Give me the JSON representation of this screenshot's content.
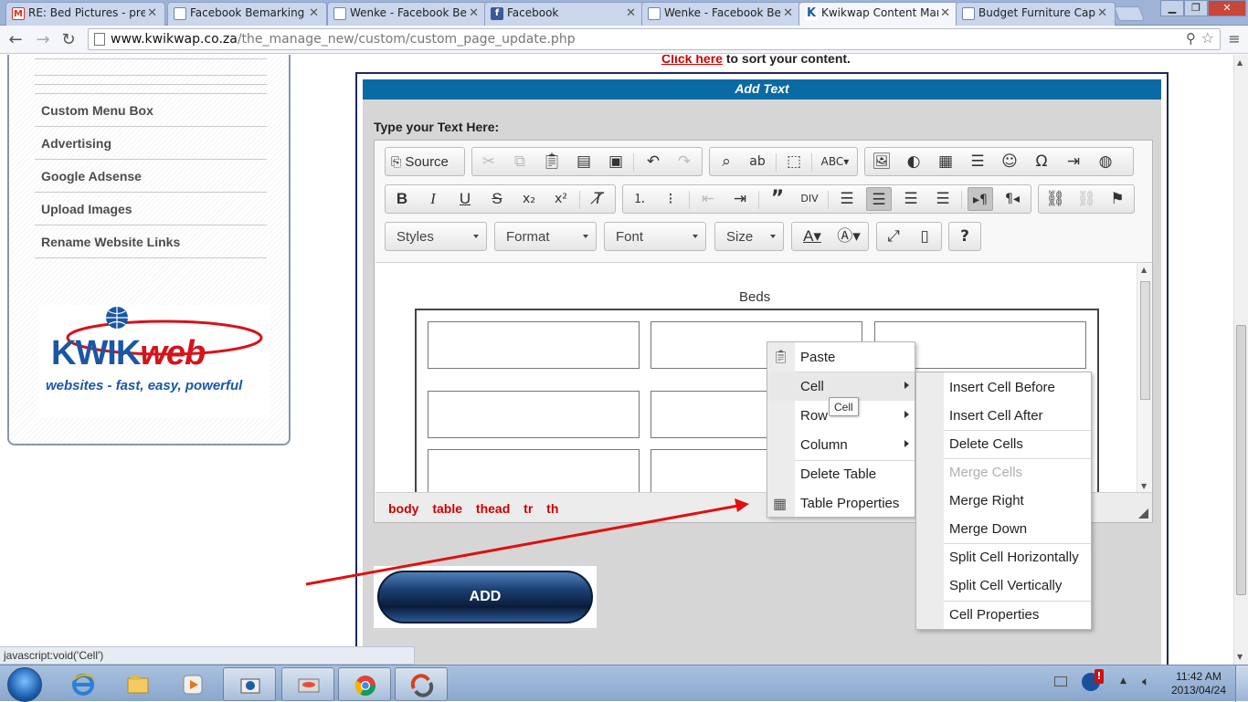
{
  "browser": {
    "tabs": [
      {
        "title": "RE: Bed Pictures - pret",
        "icon": "gmail-icon",
        "color": "#d93025"
      },
      {
        "title": "Facebook Bemarking S",
        "icon": "document-icon",
        "color": "#6d86b5"
      },
      {
        "title": "Wenke - Facebook Ber",
        "icon": "document-icon",
        "color": "#6d86b5"
      },
      {
        "title": "Facebook",
        "icon": "facebook-icon",
        "color": "#3b5998"
      },
      {
        "title": "Wenke - Facebook Ber",
        "icon": "document-icon",
        "color": "#6d86b5"
      },
      {
        "title": "Kwikwap Content Mar",
        "icon": "kwikwap-icon",
        "color": "#1a5fa8",
        "active": true
      },
      {
        "title": "Budget Furniture Cape",
        "icon": "document-icon",
        "color": "#6d86b5"
      }
    ],
    "url_host": "www.kwikwap.co.za",
    "url_path": "/the_manage_new/custom/custom_page_update.php"
  },
  "sidebar": {
    "items": [
      "Custom Menu Box",
      "Advertising",
      "Google Adsense",
      "Upload Images",
      "Rename Website Links"
    ],
    "logo_main_k": "KWIK",
    "logo_main_w": "web",
    "logo_tagline": "websites - fast, easy, powerful"
  },
  "page": {
    "sort_link": "Click here",
    "sort_text": " to sort your content.",
    "section_title": "Add Text",
    "type_label": "Type your Text Here:",
    "add_button": "ADD"
  },
  "editor": {
    "source_label": "Source",
    "combos": [
      "Styles",
      "Format",
      "Font",
      "Size"
    ],
    "caption": "Beds",
    "path": [
      "body",
      "table",
      "thead",
      "tr",
      "th"
    ]
  },
  "context_menu": {
    "items": [
      "Paste",
      "Cell",
      "Row",
      "Column",
      "Delete Table",
      "Table Properties"
    ],
    "tooltip": "Cell"
  },
  "cell_submenu": {
    "items": [
      "Insert Cell Before",
      "Insert Cell After",
      "Delete Cells",
      "Merge Cells",
      "Merge Right",
      "Merge Down",
      "Split Cell Horizontally",
      "Split Cell Vertically",
      "Cell Properties"
    ]
  },
  "status": {
    "link_preview": "javascript:void('Cell')"
  },
  "taskbar": {
    "time": "11:42 AM",
    "date": "2013/04/24"
  },
  "colors": {
    "accent_bar": "#0a6aa4",
    "path_red": "#cc0000",
    "annotation_arrow": "#e01010"
  }
}
